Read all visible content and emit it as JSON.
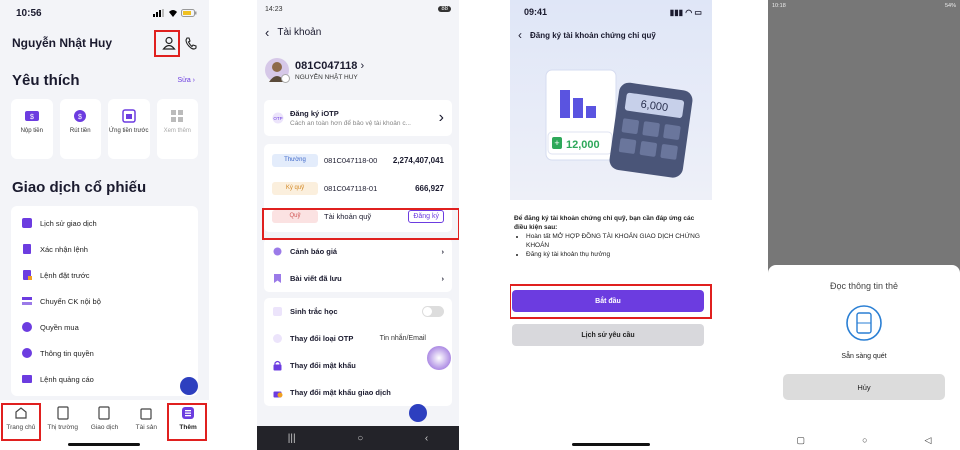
{
  "colors": {
    "accent": "#6c3ce0",
    "highlight": "#e0201f"
  },
  "p1": {
    "time": "10:56",
    "username": "Nguyễn Nhật Huy",
    "fav_title": "Yêu thích",
    "edit_label": "Sửa",
    "favorites": [
      {
        "label": "Nộp tiền",
        "icon": "deposit-icon"
      },
      {
        "label": "Rút tiền",
        "icon": "withdraw-icon"
      },
      {
        "label": "Ứng tiền trước",
        "icon": "advance-icon"
      },
      {
        "label": "Xem thêm",
        "icon": "more-grid-icon"
      }
    ],
    "stock_title": "Giao dịch cổ phiếu",
    "stock_items": [
      {
        "label": "Lịch sử giao dịch"
      },
      {
        "label": "Xác nhận lệnh"
      },
      {
        "label": "Lệnh đặt trước"
      },
      {
        "label": "Chuyển CK nội bộ"
      },
      {
        "label": "Quyền mua"
      },
      {
        "label": "Thông tin quyền"
      },
      {
        "label": "Lệnh quảng cáo"
      }
    ],
    "tabs": [
      {
        "label": "Trang chủ",
        "icon": "home-icon"
      },
      {
        "label": "Thị trường",
        "icon": "market-icon"
      },
      {
        "label": "Giao dịch",
        "icon": "trade-icon"
      },
      {
        "label": "Tài sản",
        "icon": "asset-icon"
      },
      {
        "label": "Thêm",
        "icon": "more-menu-icon"
      }
    ]
  },
  "p2": {
    "time": "14:23",
    "title": "Tài khoản",
    "account_no": "081C047118",
    "account_name": "NGUYỄN NHẬT HUY",
    "iotp_title": "Đăng ký iOTP",
    "iotp_desc": "Cách an toàn hơn để bảo vệ tài khoản c...",
    "subaccounts": [
      {
        "type": "Thường",
        "number": "081C047118-00",
        "amount": "2,274,407,041",
        "bg": "#e3ecfb",
        "fg": "#3a64c8"
      },
      {
        "type": "Ký quỹ",
        "number": "081C047118-01",
        "amount": "666,927",
        "bg": "#fbefdd",
        "fg": "#d38a28"
      },
      {
        "type": "Quỹ",
        "number": "Tài khoản quỹ",
        "action": "Đăng ký",
        "bg": "#fbe2e2",
        "fg": "#d05050"
      }
    ],
    "menu1": [
      {
        "label": "Cảnh báo giá"
      },
      {
        "label": "Bài viết đã lưu"
      }
    ],
    "menu2": [
      {
        "label": "Sinh trắc học"
      },
      {
        "label": "Thay đổi loại OTP",
        "value": "Tin nhắn/Email"
      },
      {
        "label": "Thay đổi mật khẩu"
      },
      {
        "label": "Thay đổi mật khẩu giao dịch"
      }
    ]
  },
  "p3": {
    "time": "09:41",
    "title": "Đăng ký tài khoản chứng chỉ quỹ",
    "calc_display": "6,000",
    "plus_amount": "12,000",
    "cond_head": "Để đăng ký tài khoản chứng chỉ quỹ, bạn cần đáp ứng các điều kiện sau:",
    "cond_items": [
      "Hoàn tất MỞ HỢP ĐỒNG TÀI KHOẢN GIAO DỊCH CHỨNG KHOÁN",
      "Đăng ký tài khoản thụ hưởng"
    ],
    "start_label": "Bắt đầu",
    "history_label": "Lịch sử yêu cầu"
  },
  "p4": {
    "time": "10:18",
    "battery": "54%",
    "sheet_title": "Đọc thông tin thẻ",
    "ready_text": "Sẵn sàng quét",
    "cancel_label": "Hủy"
  }
}
